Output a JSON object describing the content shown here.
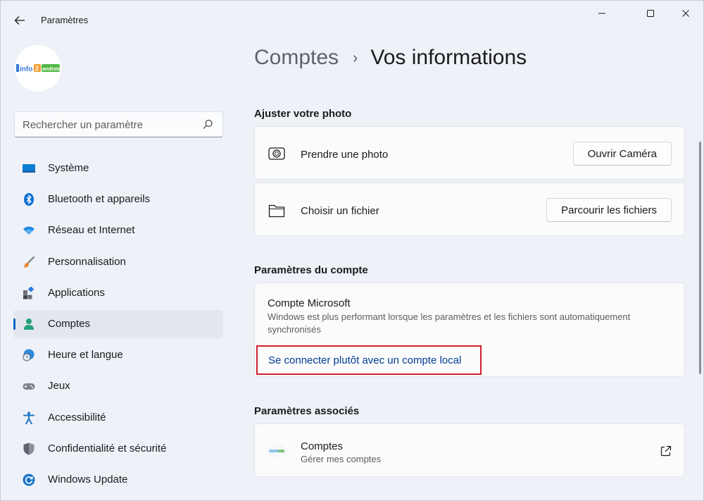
{
  "window": {
    "title": "Paramètres",
    "controls": [
      "minimize",
      "maximize",
      "close"
    ]
  },
  "sidebar": {
    "avatar_logo": "info2android",
    "search": {
      "placeholder": "Rechercher un paramètre",
      "value": ""
    },
    "items": [
      {
        "label": "Système",
        "icon": "system-icon",
        "active": false
      },
      {
        "label": "Bluetooth et appareils",
        "icon": "bluetooth-icon",
        "active": false
      },
      {
        "label": "Réseau et Internet",
        "icon": "wifi-icon",
        "active": false
      },
      {
        "label": "Personnalisation",
        "icon": "brush-icon",
        "active": false
      },
      {
        "label": "Applications",
        "icon": "apps-icon",
        "active": false
      },
      {
        "label": "Comptes",
        "icon": "person-icon",
        "active": true
      },
      {
        "label": "Heure et langue",
        "icon": "globe-clock-icon",
        "active": false
      },
      {
        "label": "Jeux",
        "icon": "gamepad-icon",
        "active": false
      },
      {
        "label": "Accessibilité",
        "icon": "accessibility-icon",
        "active": false
      },
      {
        "label": "Confidentialité et sécurité",
        "icon": "shield-icon",
        "active": false
      },
      {
        "label": "Windows Update",
        "icon": "update-icon",
        "active": false
      }
    ]
  },
  "main": {
    "breadcrumb": {
      "parent": "Comptes",
      "separator": "›",
      "current": "Vos informations"
    },
    "photo_section": {
      "title": "Ajuster votre photo",
      "take_photo": {
        "label": "Prendre une photo",
        "button": "Ouvrir Caméra"
      },
      "choose_file": {
        "label": "Choisir un fichier",
        "button": "Parcourir les fichiers"
      }
    },
    "account_section": {
      "title": "Paramètres du compte",
      "microsoft": {
        "title": "Compte Microsoft",
        "description": "Windows est plus performant lorsque les paramètres et les fichiers sont automatiquement synchronisés",
        "link": "Se connecter plutôt avec un compte local"
      }
    },
    "related_section": {
      "title": "Paramètres associés",
      "accounts": {
        "title": "Comptes",
        "subtitle": "Gérer mes comptes"
      }
    }
  },
  "colors": {
    "accent": "#0067c0",
    "link": "#003e92",
    "highlight_border": "#d0202e",
    "background": "#eef1f8",
    "card": "#fbfbfc"
  }
}
